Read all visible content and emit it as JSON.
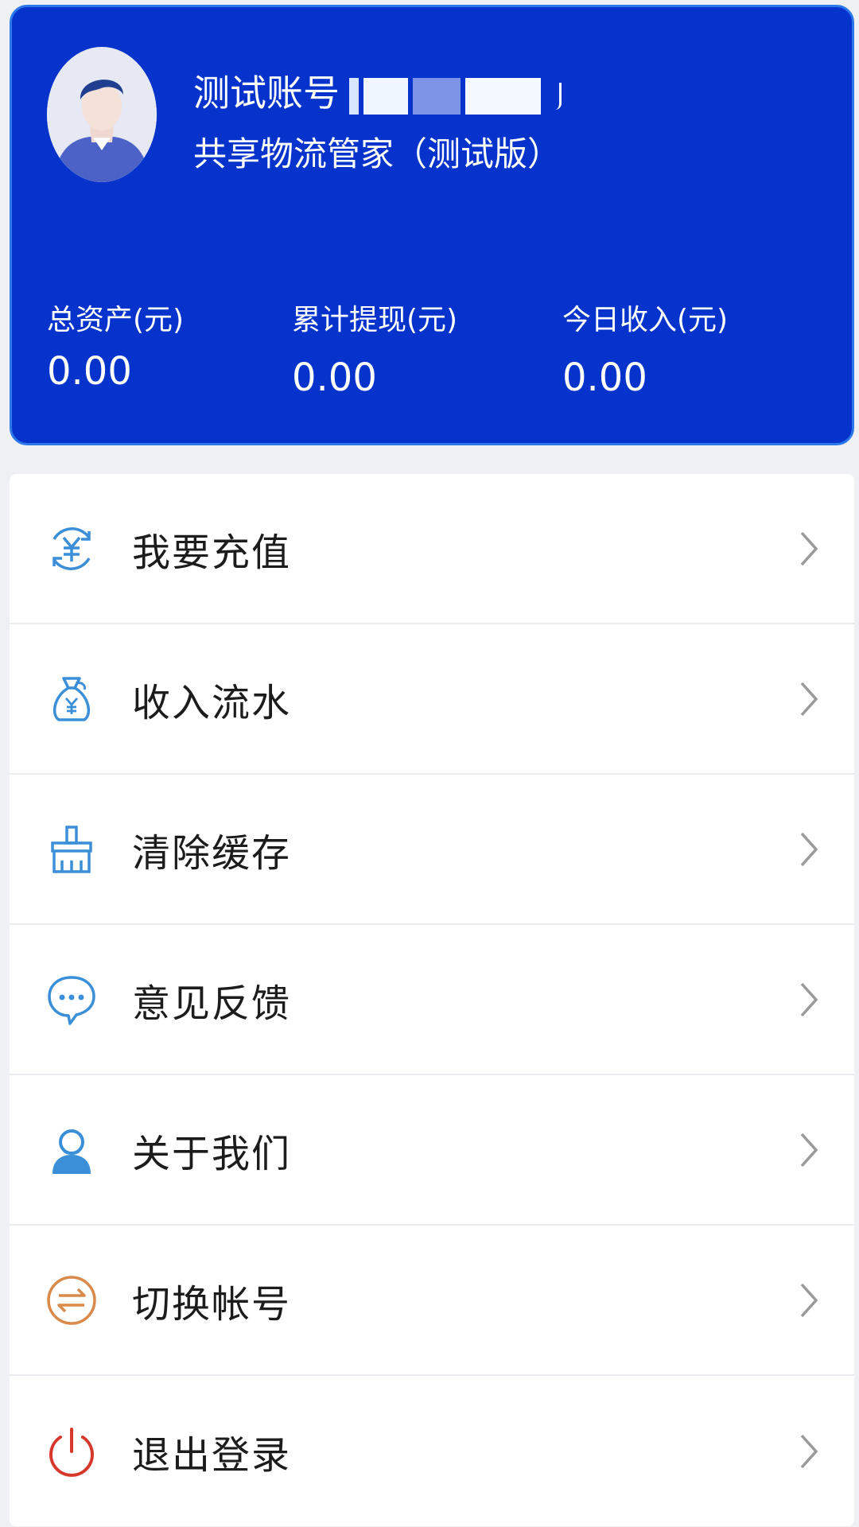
{
  "profile": {
    "account_prefix": "测试账号",
    "app_name": "共享物流管家（测试版）"
  },
  "stats": [
    {
      "label": "总资产(元)",
      "value": "0.00"
    },
    {
      "label": "累计提现(元)",
      "value": "0.00"
    },
    {
      "label": "今日收入(元)",
      "value": "0.00"
    }
  ],
  "menu": [
    {
      "label": "我要充值",
      "icon": "recharge-icon"
    },
    {
      "label": "收入流水",
      "icon": "money-bag-icon"
    },
    {
      "label": "清除缓存",
      "icon": "broom-icon"
    },
    {
      "label": "意见反馈",
      "icon": "chat-bubble-icon"
    },
    {
      "label": "关于我们",
      "icon": "person-icon"
    },
    {
      "label": "切换帐号",
      "icon": "switch-icon"
    },
    {
      "label": "退出登录",
      "icon": "power-icon"
    }
  ],
  "colors": {
    "header_bg": "#0533cc",
    "icon_blue": "#3a8fd8",
    "icon_orange": "#d9894a",
    "icon_red": "#d6392c",
    "chevron": "#9a9a9a"
  }
}
